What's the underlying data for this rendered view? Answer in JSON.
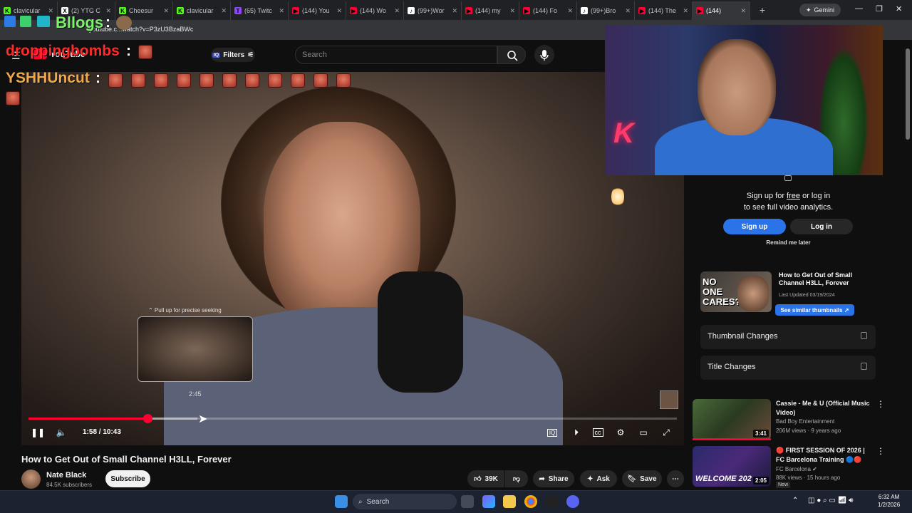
{
  "browser": {
    "tabs": [
      {
        "label": "clavicular",
        "fav": "K",
        "color": "#53fc18"
      },
      {
        "label": "(2) YTG C",
        "fav": "X",
        "color": "#ffffff"
      },
      {
        "label": "Cheesur",
        "fav": "K",
        "color": "#53fc18"
      },
      {
        "label": "clavicular",
        "fav": "K",
        "color": "#53fc18"
      },
      {
        "label": "(65) Twitc",
        "fav": "T",
        "color": "#9146ff"
      },
      {
        "label": "(144) You",
        "fav": "▶",
        "color": "#ff0033"
      },
      {
        "label": "(144) Wo",
        "fav": "▶",
        "color": "#ff0033"
      },
      {
        "label": "(99+)Wor",
        "fav": "♪",
        "color": "#ffffff"
      },
      {
        "label": "(144) my",
        "fav": "▶",
        "color": "#ff0033"
      },
      {
        "label": "(144) Fo",
        "fav": "▶",
        "color": "#ff0033"
      },
      {
        "label": "(99+)Bro",
        "fav": "♪",
        "color": "#ffffff"
      },
      {
        "label": "(144) The",
        "fav": "▶",
        "color": "#ff0033"
      },
      {
        "label": "(144)",
        "fav": "▶",
        "color": "#ff0033"
      }
    ],
    "new_tab": "+",
    "gemini_label": "Gemini",
    "url": "youtube.c...watch?v=P3zU3BzaBWc"
  },
  "overlay": {
    "user1": "droppingbombs",
    "user2": "YSHHUncut",
    "user3": "Bllogs",
    "colon": ":"
  },
  "header": {
    "logo": "YouTube",
    "filters_label": "Filters",
    "search_placeholder": "Search"
  },
  "player": {
    "seek_hint": "⌃ Pull up for precise seeking",
    "seek_time": "2:45",
    "current_time": "1:58 / 10:43",
    "progress": 0.184,
    "buffered": 0.26
  },
  "analytics": {
    "text_line1_a": "Sign up for ",
    "text_line1_free": "free",
    "text_line1_b": " or log in",
    "text_line2": "to see full video analytics.",
    "signup": "Sign up",
    "login": "Log in",
    "remind": "Remind me later",
    "thumb_text": "NO ONE CARES?",
    "thumb_title": "How to Get Out of Small Channel H3LL, Forever",
    "updated": "Last Updated 03/19/2024",
    "similar": "See similar thumbnails ↗",
    "row1": "Thumbnail Changes",
    "row2": "Title Changes"
  },
  "recommended": [
    {
      "title": "Cassie - Me & U (Official Music Video)",
      "channel": "Bad Boy Entertainment",
      "meta": "206M views · 9 years ago",
      "duration": "3:41"
    },
    {
      "title": "🔴 FIRST SESSION OF 2026 | FC Barcelona Training 🔵🔴",
      "channel": "FC Barcelona ✔",
      "meta": "88K views · 15 hours ago",
      "duration": "2:05",
      "badge": "New",
      "thumb_text": "WELCOME 202"
    }
  ],
  "video": {
    "title": "How to Get Out of Small Channel H3LL, Forever",
    "channel": "Nate Black",
    "subs": "84.5K subscribers",
    "subscribe": "Subscribe",
    "likes": "39K",
    "share": "Share",
    "ask": "Ask",
    "save": "Save"
  },
  "taskbar": {
    "search": "Search",
    "time": "6:32 AM",
    "date": "1/2/2026"
  },
  "colors": {
    "accent_red": "#ff0033",
    "accent_blue": "#2a73e8"
  }
}
